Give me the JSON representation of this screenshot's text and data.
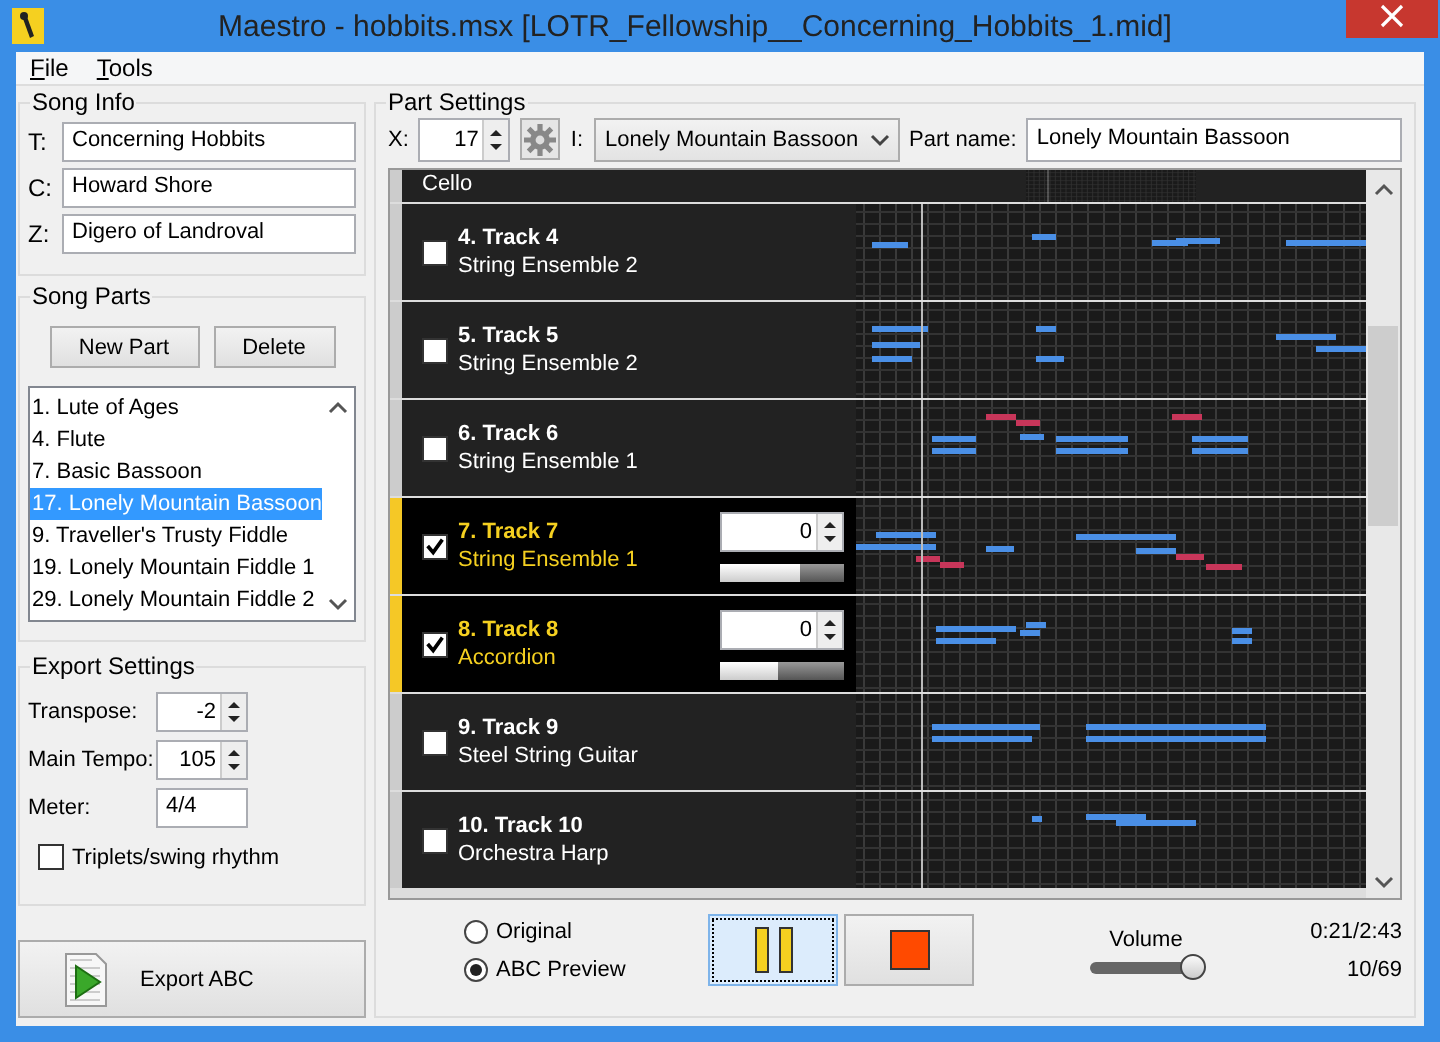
{
  "window": {
    "title": "Maestro - hobbits.msx [LOTR_Fellowship__Concerning_Hobbits_1.mid]"
  },
  "menu": [
    "File",
    "Tools"
  ],
  "song_info": {
    "title": "Song Info",
    "fields": [
      {
        "label": "T:",
        "value": "Concerning Hobbits"
      },
      {
        "label": "C:",
        "value": "Howard Shore"
      },
      {
        "label": "Z:",
        "value": "Digero of Landroval"
      }
    ]
  },
  "song_parts": {
    "title": "Song Parts",
    "buttons": [
      "New Part",
      "Delete"
    ],
    "items": [
      {
        "label": "1. Lute of Ages",
        "selected": false
      },
      {
        "label": "4. Flute",
        "selected": false
      },
      {
        "label": "7. Basic Bassoon",
        "selected": false
      },
      {
        "label": "17. Lonely Mountain Bassoon",
        "selected": true
      },
      {
        "label": "9. Traveller's Trusty Fiddle",
        "selected": false
      },
      {
        "label": "19. Lonely Mountain Fiddle 1",
        "selected": false
      },
      {
        "label": "29. Lonely Mountain Fiddle 2",
        "selected": false
      }
    ]
  },
  "export_settings": {
    "title": "Export Settings",
    "transpose": {
      "label": "Transpose:",
      "value": "-2"
    },
    "tempo": {
      "label": "Main Tempo:",
      "value": "105"
    },
    "meter": {
      "label": "Meter:",
      "value": "4/4"
    },
    "triplets": {
      "label": "Triplets/swing rhythm",
      "checked": false
    },
    "export_button": "Export ABC"
  },
  "part_settings": {
    "title": "Part Settings",
    "x": {
      "label": "X:",
      "value": "17"
    },
    "instrument": {
      "label": "I:",
      "value": "Lonely Mountain Bassoon"
    },
    "part_name": {
      "label": "Part name:",
      "value": "Lonely Mountain Bassoon"
    }
  },
  "tracks": [
    {
      "instrument": "Cello"
    },
    {
      "title": "4. Track 4",
      "instrument": "String Ensemble 2",
      "checked": false,
      "selected": false
    },
    {
      "title": "5. Track 5",
      "instrument": "String Ensemble 2",
      "checked": false,
      "selected": false
    },
    {
      "title": "6. Track 6",
      "instrument": "String Ensemble 1",
      "checked": false,
      "selected": false
    },
    {
      "title": "7. Track 7",
      "instrument": "String Ensemble 1",
      "checked": true,
      "selected": true,
      "transpose": "0",
      "level": 0.65
    },
    {
      "title": "8. Track 8",
      "instrument": "Accordion",
      "checked": true,
      "selected": true,
      "transpose": "0",
      "level": 0.47
    },
    {
      "title": "9. Track 9",
      "instrument": "Steel String Guitar",
      "checked": false,
      "selected": false
    },
    {
      "title": "10. Track 10",
      "instrument": "Orchestra Harp",
      "checked": false,
      "selected": false
    }
  ],
  "playback": {
    "modes": [
      {
        "label": "Original",
        "selected": false
      },
      {
        "label": "ABC Preview",
        "selected": true
      }
    ],
    "volume": {
      "label": "Volume",
      "level": 0.93
    },
    "time": "0:21/2:43",
    "bar": "10/69"
  }
}
